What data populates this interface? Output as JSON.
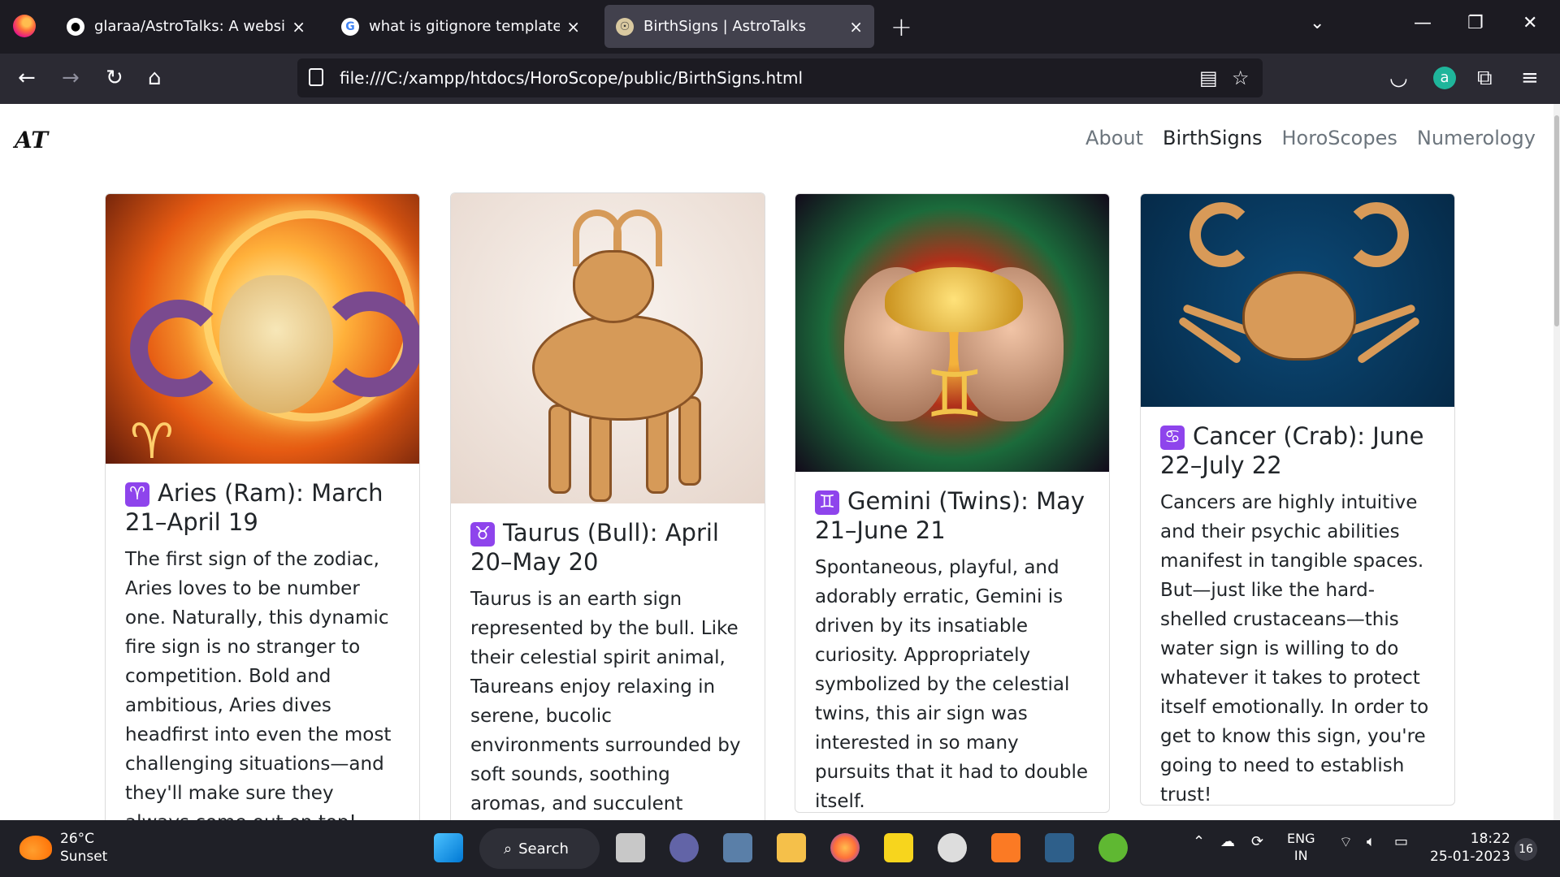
{
  "browser": {
    "tabs": [
      {
        "label": "glaraa/AstroTalks: A website wh",
        "icon": "github-icon"
      },
      {
        "label": "what is gitignore template - Go",
        "icon": "google-icon"
      },
      {
        "label": "BirthSigns | AstroTalks",
        "icon": "astrotalks-icon",
        "active": true
      }
    ],
    "url": "file:///C:/xampp/htdocs/HoroScope/public/BirthSigns.html"
  },
  "site": {
    "brand": "AT",
    "nav": {
      "about": "About",
      "birthsigns": "BirthSigns",
      "horoscopes": "HoroScopes",
      "numerology": "Numerology"
    }
  },
  "cards": [
    {
      "glyph": "♈",
      "title": "Aries (Ram): March 21–April 19",
      "text": "The first sign of the zodiac, Aries loves to be number one. Naturally, this dynamic fire sign is no stranger to competition. Bold and ambitious, Aries dives headfirst into even the most challenging situations—and they'll make sure they always come out on top!"
    },
    {
      "glyph": "♉",
      "title": "Taurus (Bull): April 20–May 20",
      "text": "Taurus is an earth sign represented by the bull. Like their celestial spirit animal, Taureans enjoy relaxing in serene, bucolic environments surrounded by soft sounds, soothing aromas, and succulent flavors."
    },
    {
      "glyph": "♊",
      "title": "Gemini (Twins): May 21–June 21",
      "text": "Spontaneous, playful, and adorably erratic, Gemini is driven by its insatiable curiosity. Appropriately symbolized by the celestial twins, this air sign was interested in so many pursuits that it had to double itself."
    },
    {
      "glyph": "♋",
      "title": "Cancer (Crab): June 22–July 22",
      "text": "Cancers are highly intuitive and their psychic abilities manifest in tangible spaces. But—just like the hard-shelled crustaceans—this water sign is willing to do whatever it takes to protect itself emotionally. In order to get to know this sign, you're going to need to establish trust!"
    }
  ],
  "taskbar": {
    "weather_temp": "26°C",
    "weather_desc": "Sunset",
    "search_label": "Search",
    "lang_top": "ENG",
    "lang_bottom": "IN",
    "time": "18:22",
    "date": "25-01-2023",
    "notifications": "16"
  }
}
